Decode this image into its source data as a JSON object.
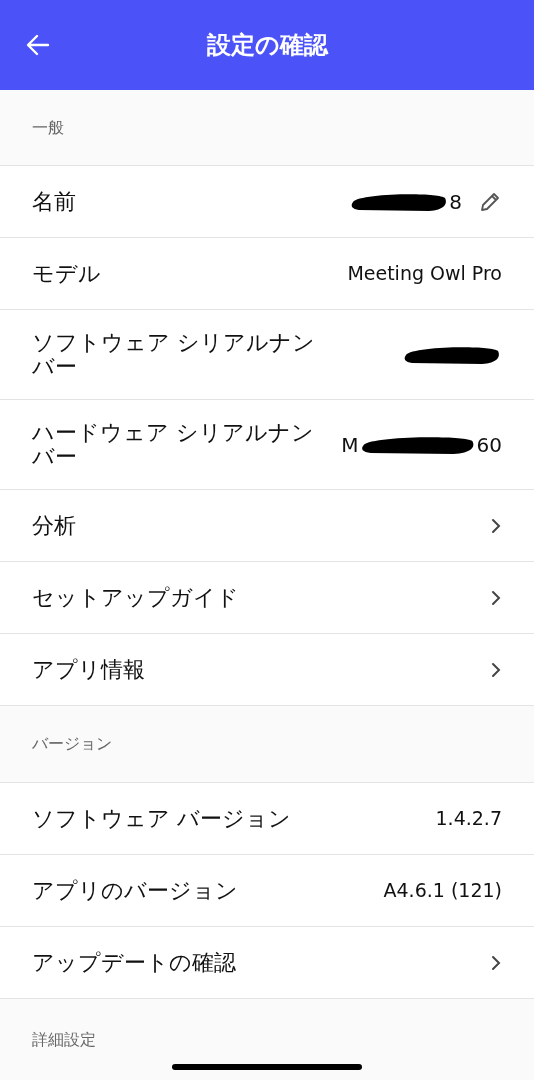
{
  "header": {
    "title": "設定の確認"
  },
  "sections": [
    {
      "title": "一般",
      "rows": [
        {
          "kind": "redacted",
          "label": "名前",
          "prefix": "",
          "suffix": "8",
          "editable": true
        },
        {
          "kind": "value",
          "label": "モデル",
          "value": "Meeting Owl Pro"
        },
        {
          "kind": "redacted",
          "label": "ソフトウェア シリアルナンバー",
          "prefix": "",
          "suffix": "",
          "editable": false
        },
        {
          "kind": "redacted",
          "label": "ハードウェア シリアルナンバー",
          "prefix": "M",
          "suffix": "60",
          "editable": false
        },
        {
          "kind": "link",
          "label": "分析"
        },
        {
          "kind": "link",
          "label": "セットアップガイド"
        },
        {
          "kind": "link",
          "label": "アプリ情報"
        }
      ]
    },
    {
      "title": "バージョン",
      "rows": [
        {
          "kind": "value",
          "label": "ソフトウェア バージョン",
          "value": "1.4.2.7"
        },
        {
          "kind": "value",
          "label": "アプリのバージョン",
          "value": "A4.6.1 (121)"
        },
        {
          "kind": "link",
          "label": "アップデートの確認"
        }
      ]
    },
    {
      "title": "詳細設定"
    }
  ]
}
